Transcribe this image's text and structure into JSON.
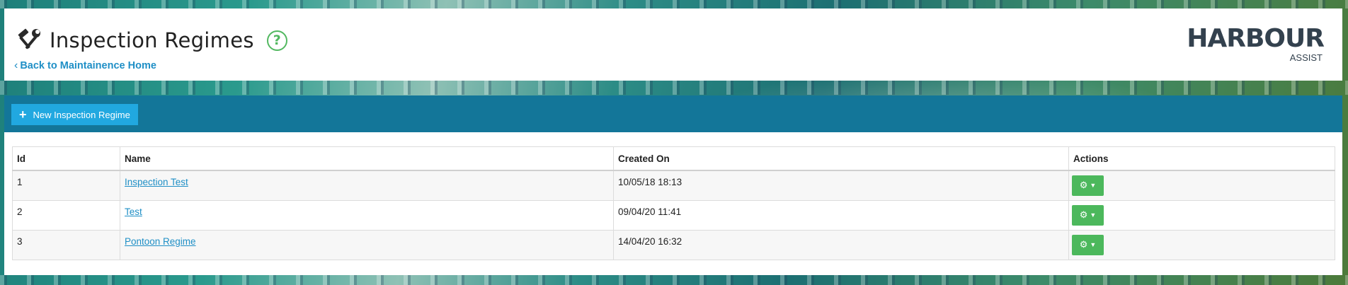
{
  "header": {
    "title": "Inspection Regimes",
    "help_icon_glyph": "?",
    "back_link": "Back to Maintainence Home",
    "back_icon": "chevron-left-icon",
    "title_icon": "tools-icon"
  },
  "logo": {
    "main": "HARBOUR",
    "sub": "ASSIST"
  },
  "toolbar": {
    "new_button_label": "New Inspection Regime"
  },
  "table": {
    "columns": [
      "Id",
      "Name",
      "Created On",
      "Actions"
    ],
    "rows": [
      {
        "id": "1",
        "name": "Inspection Test",
        "created_on": "10/05/18 18:13"
      },
      {
        "id": "2",
        "name": "Test",
        "created_on": "09/04/20 11:41"
      },
      {
        "id": "3",
        "name": "Pontoon Regime",
        "created_on": "14/04/20 16:32"
      }
    ]
  },
  "colors": {
    "accent_blue": "#21a8e0",
    "toolbar_bg": "#137699",
    "action_green": "#4cb85c",
    "link_blue": "#1f8fc6"
  }
}
